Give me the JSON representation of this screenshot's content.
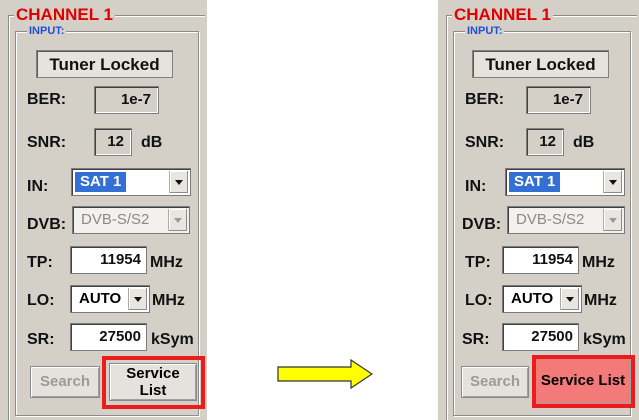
{
  "panels": [
    {
      "channel_title": "CHANNEL 1",
      "input_title": "INPUT:",
      "status": "Tuner Locked",
      "ber": {
        "label": "BER:",
        "value": "1e-7"
      },
      "snr": {
        "label": "SNR:",
        "value": "12",
        "unit": "dB"
      },
      "in": {
        "label": "IN:",
        "value": "SAT 1"
      },
      "dvb": {
        "label": "DVB:",
        "value": "DVB-S/S2"
      },
      "tp": {
        "label": "TP:",
        "value": "11954",
        "unit": "MHz"
      },
      "lo": {
        "label": "LO:",
        "value": "AUTO",
        "unit": "MHz"
      },
      "sr": {
        "label": "SR:",
        "value": "27500",
        "unit": "kSym"
      },
      "search_label": "Search",
      "service_list_line1": "Service",
      "service_list_line2": "List"
    },
    {
      "channel_title": "CHANNEL 1",
      "input_title": "INPUT:",
      "status": "Tuner Locked",
      "ber": {
        "label": "BER:",
        "value": "1e-7"
      },
      "snr": {
        "label": "SNR:",
        "value": "12",
        "unit": "dB"
      },
      "in": {
        "label": "IN:",
        "value": "SAT 1"
      },
      "dvb": {
        "label": "DVB:",
        "value": "DVB-S/S2"
      },
      "tp": {
        "label": "TP:",
        "value": "11954",
        "unit": "MHz"
      },
      "lo": {
        "label": "LO:",
        "value": "AUTO",
        "unit": "MHz"
      },
      "sr": {
        "label": "SR:",
        "value": "27500",
        "unit": "kSym"
      },
      "search_label": "Search",
      "service_list_label": "Service List"
    }
  ],
  "colors": {
    "channel_title": "#e00000",
    "input_title": "#1f4fd8",
    "highlight": "#ec1c1c",
    "arrow_fill": "#ffff00",
    "service_list_active_bg": "#f47a7a",
    "selection_bg": "#3370d5"
  },
  "arrow": {
    "icon": "right-arrow-icon"
  }
}
